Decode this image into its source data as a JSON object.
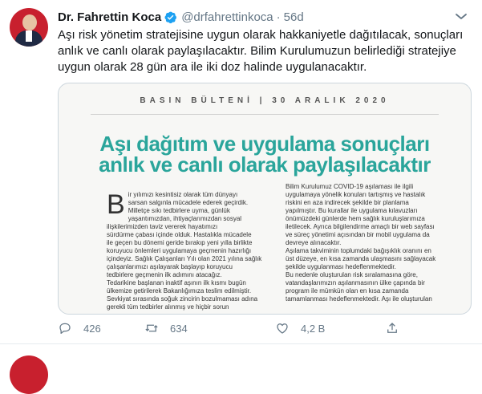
{
  "tweet": {
    "author_name": "Dr. Fahrettin Koca",
    "handle": "@drfahrettinkoca",
    "separator": "·",
    "time": "56d",
    "text": "Aşı risk yönetim stratejisine uygun olarak hakkaniyetle dağıtılacak, sonuçları\nanlık ve canlı olarak paylaşılacaktır. Bilim Kurulumuzun belirlediği stratejiye\nuygun olarak 28 gün ara ile iki doz halinde uygulanacaktır."
  },
  "media": {
    "header": "BASIN BÜLTENİ  |  30 ARALIK 2020",
    "headline": "Aşı dağıtım ve uygulama sonuçları\nanlık ve canlı olarak paylaşılacaktır",
    "dropcap": "B",
    "left_column": "ir yılımızı kesintisiz olarak tüm dünyayı\nsarsan salgınla mücadele ederek geçirdik.\nMilletçe sıkı tedbirlere uyma, günlük\nyaşantımızdan, ihtiyaçlarımızdan sosyal\nilişkilerimizden taviz vererek hayatımızı\nsürdürme çabası içinde olduk. Hastalıkla mücadele\nile geçen bu dönemi geride bırakıp yeni yılla birlikte\nkoruyucu önlemleri uygulamaya geçmenin hazırlığı\niçindeyiz. Sağlık Çalışanları Yılı olan 2021 yılına sağlık\nçalışanlarımızı aşılayarak başlayıp koruyucu\ntedbirlere geçmenin ilk adımını atacağız.\nTedarikine başlanan inaktif aşının ilk kısmı bugün\nülkemize getirilerek Bakanlığımıza teslim edilmiştir.\nSevkiyat sırasında soğuk zincirin bozulmaması adına\ngerekli tüm tedbirler alınmış ve hiçbir sorun",
    "right_column": "Bilim Kurulumuz COVID-19 aşılaması ile ilgili\nuygulamaya yönelik konuları tartışmış ve hastalık\nriskini en aza indirecek şekilde bir planlama\nyapılmıştır. Bu kurallar ile uygulama kılavuzları\nönümüzdeki günlerde hem sağlık kuruluşlarımıza\niletilecek. Ayrıca bilgilendirme amaçlı bir web sayfası\nve süreç yönetimi açısından bir mobil uygulama da\ndevreye alınacaktır.\nAşılama takviminin toplumdaki bağışıklık oranını en\nüst düzeye, en kısa zamanda ulaşmasını sağlayacak\nşekilde uygulanması hedeflenmektedir.\nBu nedenle oluşturulan risk sıralamasına göre,\nvatandaşlarımızın aşılanmasının ülke çapında bir\nprogram ile mümkün olan en kısa zamanda\ntamamlanması hedeflenmektedir. Aşı ile oluşturulan"
  },
  "actions": {
    "reply_count": "426",
    "retweet_count": "634",
    "like_count": "4,2 B"
  },
  "colors": {
    "verified": "#1da1f2",
    "headline": "#2aa59b",
    "muted": "#657786",
    "border": "#ccd6dd"
  },
  "icons": [
    "verified-badge-icon",
    "more-icon",
    "reply-icon",
    "retweet-icon",
    "like-icon",
    "share-icon"
  ]
}
